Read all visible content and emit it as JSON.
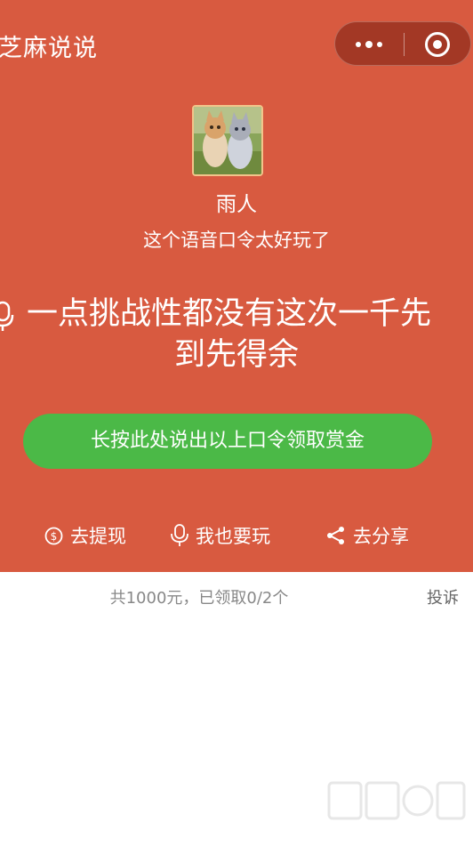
{
  "header": {
    "app_title": "芝麻说说",
    "more_icon": "more-dots-icon",
    "close_icon": "target-close-icon"
  },
  "sender": {
    "name": "雨人",
    "message": "这个语音口令太好玩了"
  },
  "voice_command": {
    "icon": "microphone-icon",
    "line1": "一点挑战性都没有这次一千先",
    "line2": "到先得余"
  },
  "record_button": {
    "label": "长按此处说出以上口令领取赏金"
  },
  "actions": [
    {
      "label": "去提现",
      "icon": "dollar-circle-icon"
    },
    {
      "label": "我也要玩",
      "icon": "microphone-icon"
    },
    {
      "label": "去分享",
      "icon": "share-icon"
    }
  ],
  "footer": {
    "summary": "共1000元，已领取0/2个",
    "report": "投诉"
  },
  "colors": {
    "hero_bg": "#d85a40",
    "button_green": "#4bb947"
  }
}
